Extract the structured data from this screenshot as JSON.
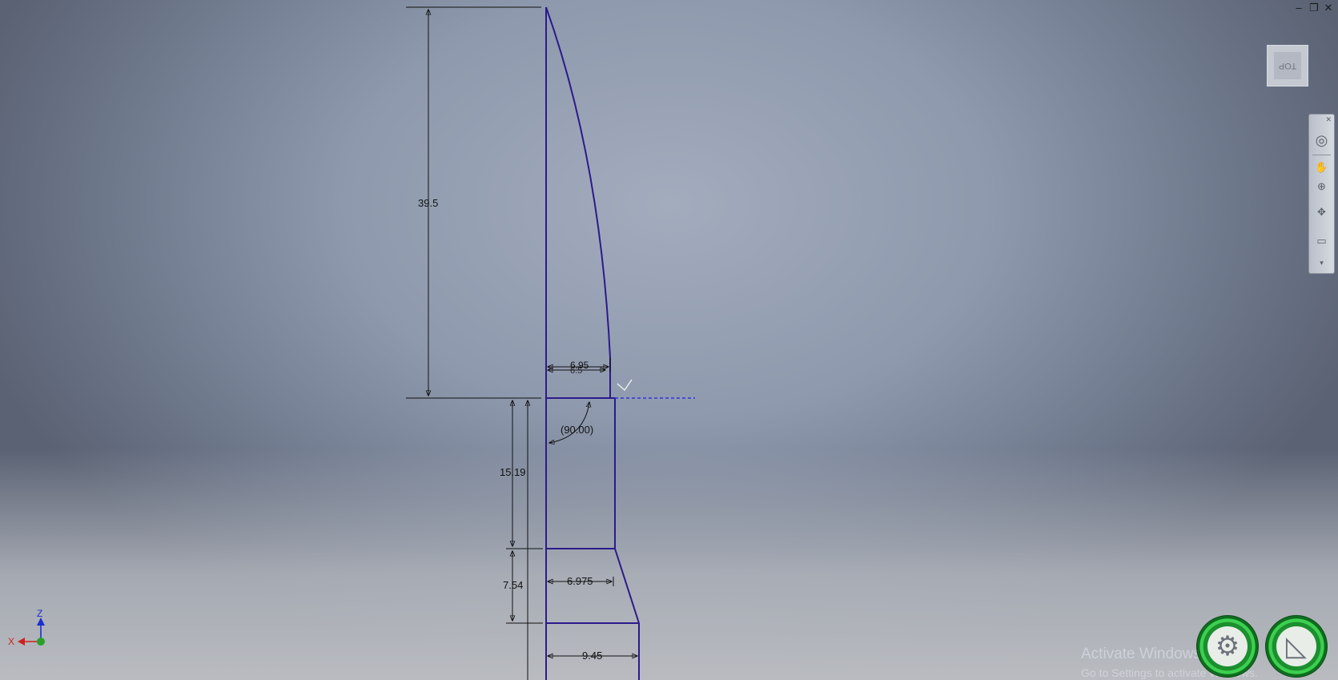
{
  "window_controls": {
    "minimize": "–",
    "restore": "❐",
    "close": "✕"
  },
  "viewcube": {
    "face_label": "TOP"
  },
  "navbar": {
    "icons": [
      "close-icon",
      "steering-wheel-icon",
      "pan-hand-icon",
      "zoom-icon",
      "orbit-icon",
      "view-face-icon",
      "customize-icon"
    ]
  },
  "sketch": {
    "dimensions": {
      "height_top": "39.5",
      "width_upper_a": "6.95",
      "width_upper_b": "6.5",
      "angle": "(90.00)",
      "height_mid": "15.19",
      "height_taper": "7.54",
      "width_mid": "6.975",
      "width_bottom": "9.45"
    },
    "line_color": "#2c1a8c",
    "dim_color": "#111111",
    "construction_color": "#1e1ee8"
  },
  "triad": {
    "z_label": "Z",
    "x_label": "X",
    "z_color": "#1a2fd0",
    "x_color": "#d02020",
    "y_color": "#2aa02a"
  },
  "watermark": {
    "line1": "Activate Windows",
    "line2": "Go to Settings to activate Windows."
  },
  "gauges": [
    {
      "icon": "gear-gauge-icon"
    },
    {
      "icon": "sketch-gauge-icon"
    }
  ]
}
